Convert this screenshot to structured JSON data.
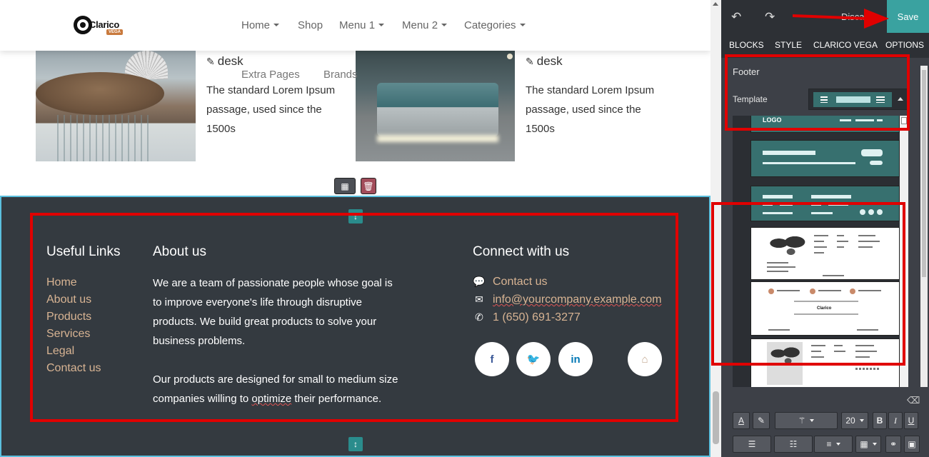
{
  "nav": {
    "brand": "Clarico",
    "brand_badge": "VEGA",
    "items": [
      "Home",
      "Shop",
      "Menu 1",
      "Menu 2",
      "Categories"
    ],
    "overflow": [
      "Extra Pages",
      "Brands"
    ]
  },
  "products": [
    {
      "title": "desk",
      "text": "The standard Lorem Ipsum passage, used since the 1500s"
    },
    {
      "title": "desk",
      "text": "The standard Lorem Ipsum passage, used since the 1500s"
    }
  ],
  "footer": {
    "links_title": "Useful Links",
    "links": [
      "Home",
      "About us",
      "Products",
      "Services",
      "Legal",
      "Contact us"
    ],
    "about_title": "About us",
    "about_p1": "We are a team of passionate people whose goal is to improve everyone's life through disruptive products. We build great products to solve your business problems.",
    "about_p2_before": "Our products are designed for small to medium size companies willing to ",
    "about_p2_sq": "optimize",
    "about_p2_after": " their performance.",
    "connect_title": "Connect with us",
    "contact_label": "Contact us",
    "email": "info@yourcompany.example.com",
    "phone": "1 (650) 691-3277"
  },
  "editor": {
    "discard_label": "Discard",
    "save_label": "Save",
    "tabs": [
      "BLOCKS",
      "STYLE",
      "CLARICO VEGA",
      "OPTIONS"
    ],
    "active_tab": "STYLE",
    "section_title": "Footer",
    "template_label": "Template",
    "template_preview_text": "LOGO",
    "font_size": "20"
  },
  "colors": {
    "footer_bg": "#343a40",
    "link_color": "#d8b493",
    "save_bg": "#3aa2a0",
    "annotation_red": "#e00000",
    "teal_template": "#37706f"
  }
}
